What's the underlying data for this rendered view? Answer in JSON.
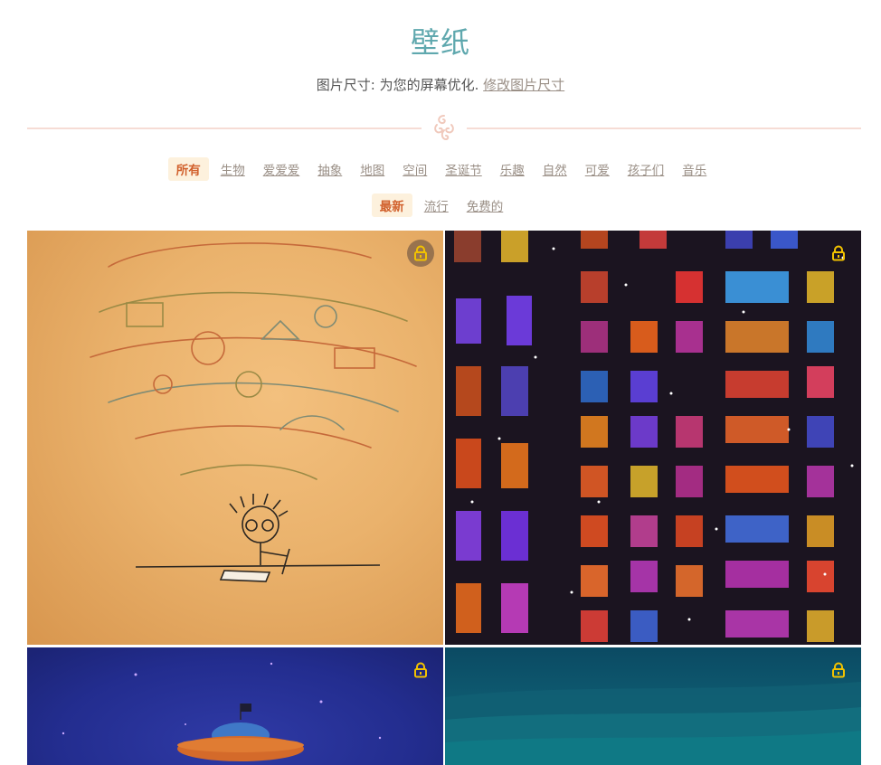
{
  "header": {
    "title": "壁纸",
    "size_prefix": "图片尺寸: 为您的屏幕优化.",
    "size_link": "修改图片尺寸"
  },
  "categories": [
    "所有",
    "生物",
    "爱爱爱",
    "抽象",
    "地图",
    "空间",
    "圣诞节",
    "乐趣",
    "自然",
    "可爱",
    "孩子们",
    "音乐"
  ],
  "sort": [
    "最新",
    "流行",
    "免费的"
  ],
  "active": {
    "category": 0,
    "sort": 0
  },
  "colors": {
    "title": "#5fa8ae",
    "active_text": "#d1602c",
    "active_bg": "#fdf1dd",
    "lock": "#f2c200"
  },
  "wallpapers": [
    {
      "icon": "lock-icon",
      "locked": true
    },
    {
      "icon": "lock-icon",
      "locked": true
    },
    {
      "icon": "lock-icon",
      "locked": true
    },
    {
      "icon": "lock-icon",
      "locked": true
    }
  ]
}
